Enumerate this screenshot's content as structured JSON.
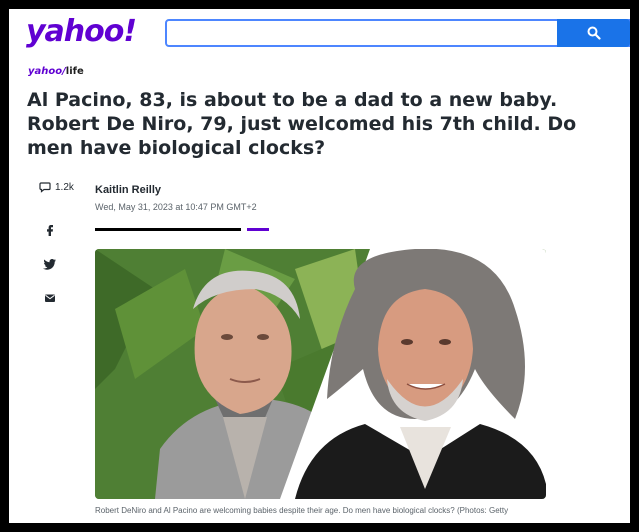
{
  "header": {
    "logo": "yahoo!",
    "search": {
      "placeholder": "",
      "value": ""
    },
    "search_button_icon": "search-icon"
  },
  "section": {
    "brand": "yahoo/",
    "name": "life"
  },
  "article": {
    "title": "Al Pacino, 83, is about to be a dad to a new baby. Robert De Niro, 79, just welcomed his 7th child. Do men have biological clocks?",
    "author": "Kaitlin Reilly",
    "date": "Wed, May 31, 2023 at 10:47 PM GMT+2",
    "comment_count": "1.2k",
    "caption": "Robert DeNiro and Al Pacino are welcoming babies despite their age. Do men have biological clocks? (Photos: Getty"
  },
  "share": {
    "icons": [
      "comment-icon",
      "facebook-icon",
      "twitter-icon",
      "email-icon"
    ]
  },
  "colors": {
    "brand": "#6001d2",
    "search_border": "#4d86ff",
    "search_button": "#1a73e8"
  }
}
